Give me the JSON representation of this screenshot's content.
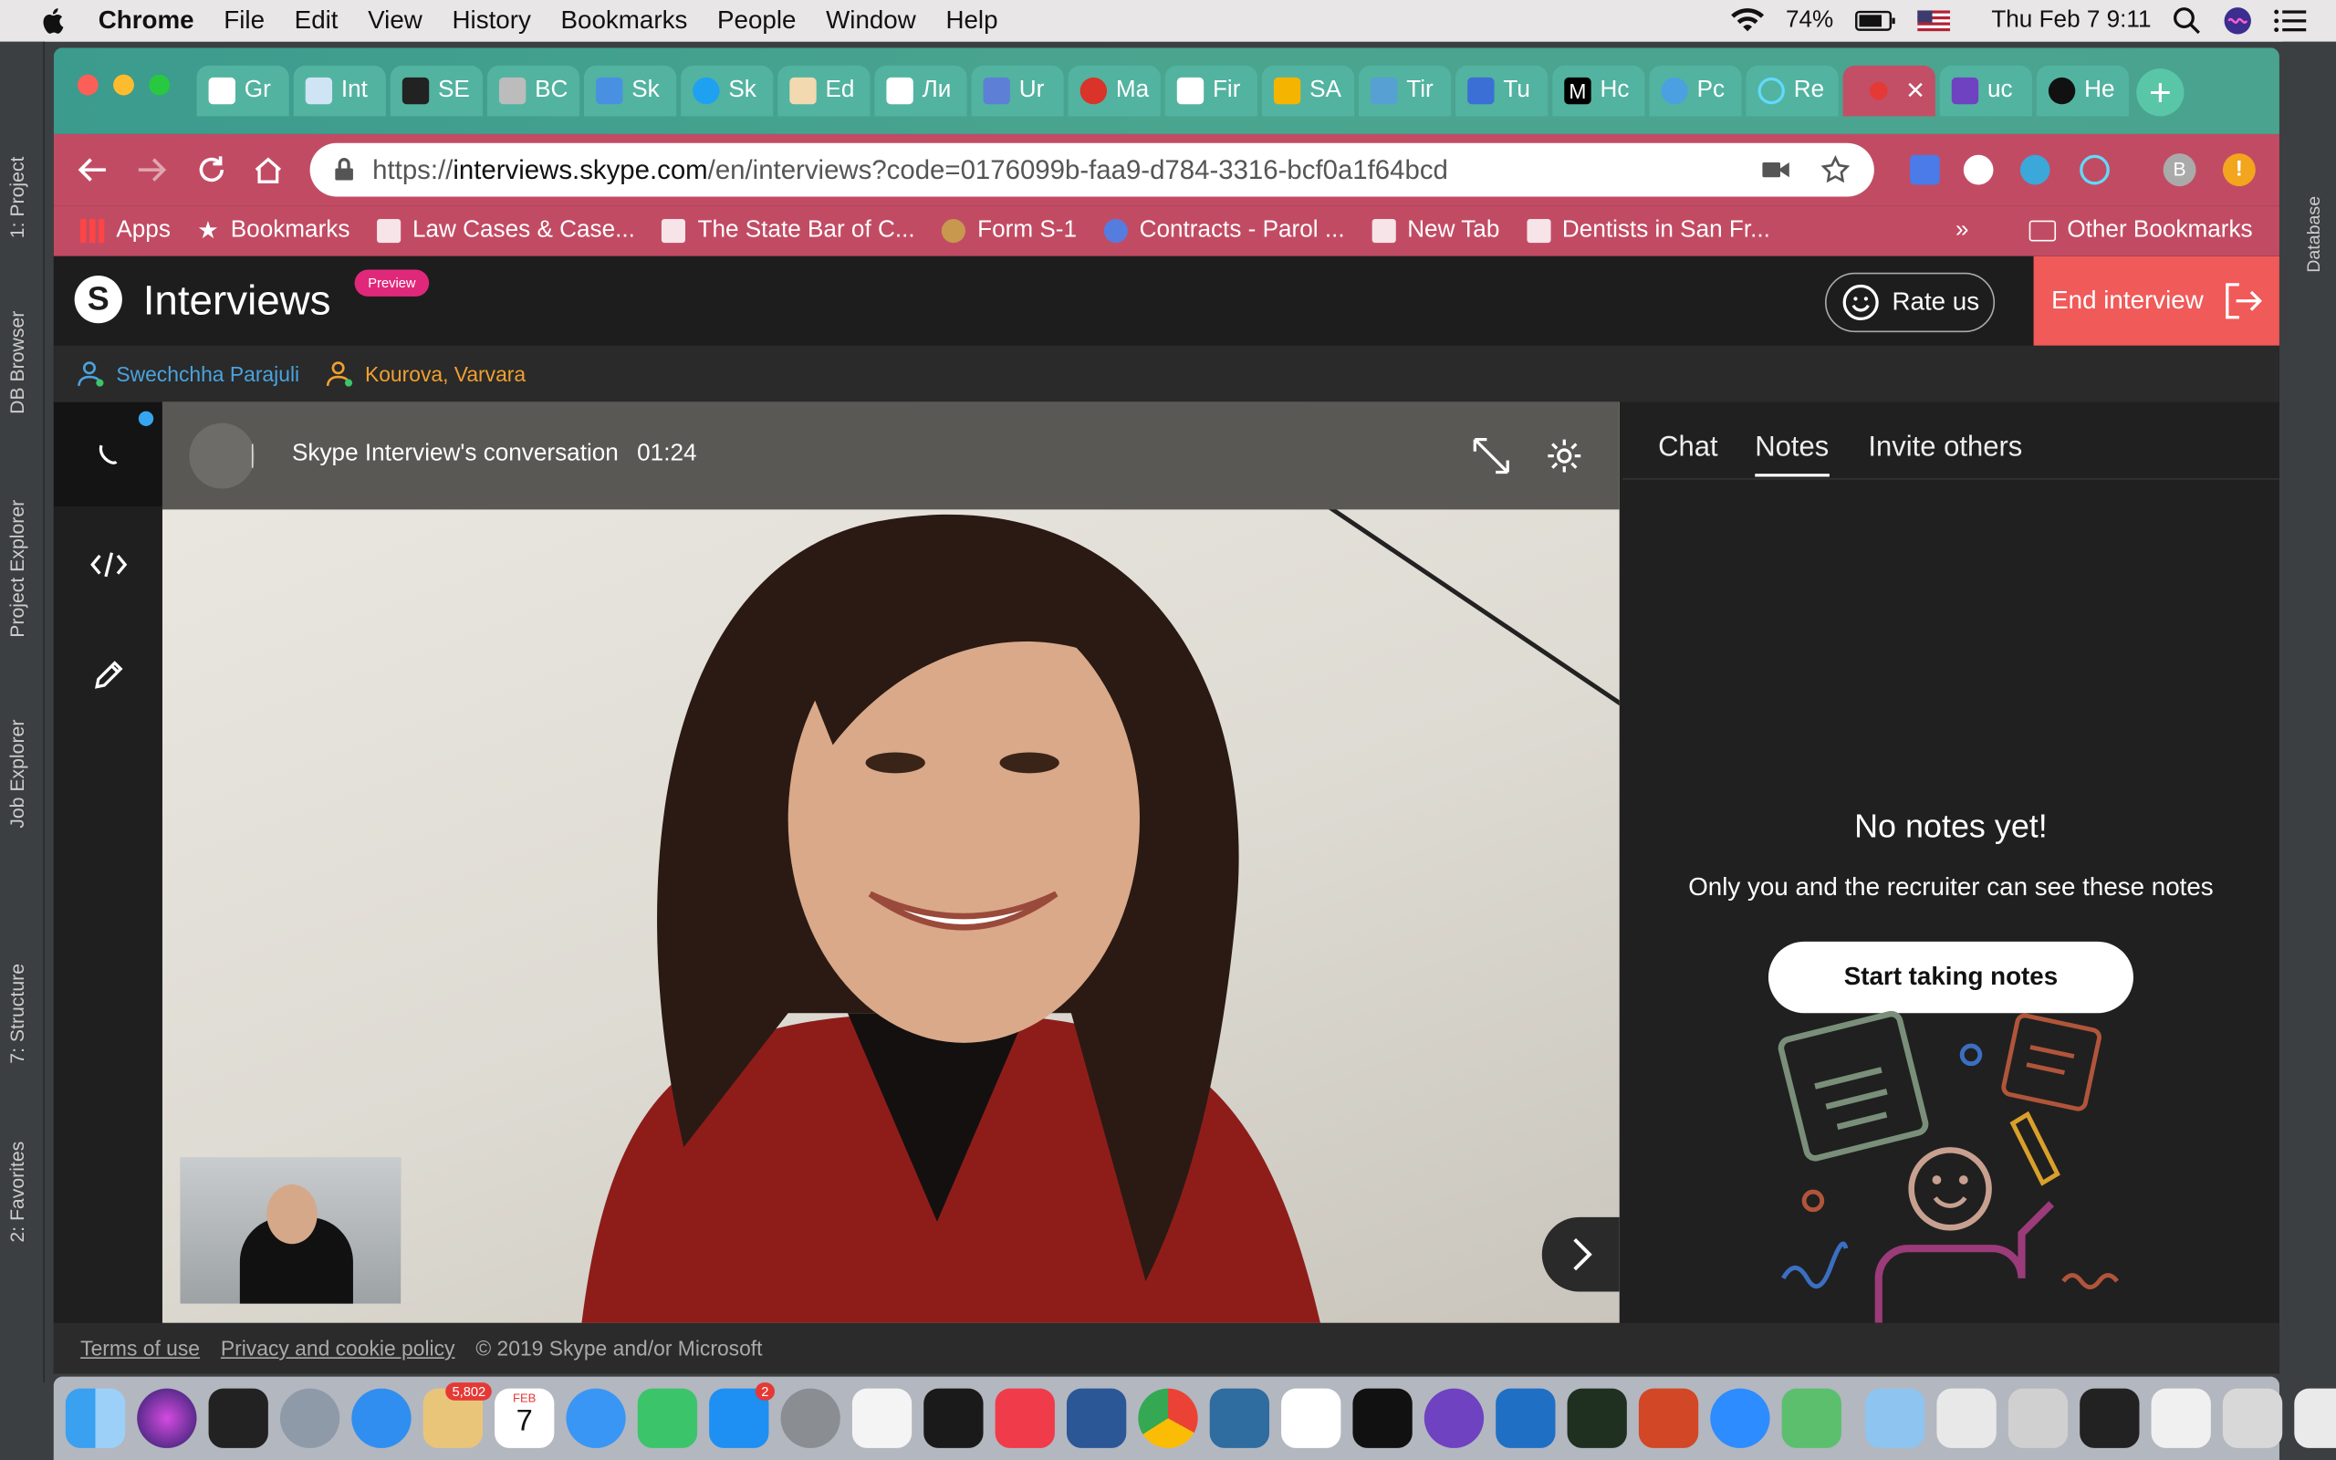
{
  "menubar": {
    "app": "Chrome",
    "items": [
      "File",
      "Edit",
      "View",
      "History",
      "Bookmarks",
      "People",
      "Window",
      "Help"
    ],
    "battery": "74%",
    "datetime": "Thu Feb 7  9:11"
  },
  "ide": {
    "left_tabs": [
      "1: Project",
      "DB Browser",
      "Project Explorer",
      "Job Explorer",
      "7: Structure",
      "2: Favorites"
    ],
    "right_tabs": [
      "Database"
    ]
  },
  "tabs": [
    {
      "label": "Gr",
      "icon": "doc-icon",
      "color": "#ffffff"
    },
    {
      "label": "Int",
      "icon": "bank-icon",
      "color": "#e9e9e9"
    },
    {
      "label": "SE",
      "icon": "r-icon",
      "color": "#222222"
    },
    {
      "label": "BC",
      "icon": "gear-globe-icon",
      "color": "#bcbcbc"
    },
    {
      "label": "Sk",
      "icon": "robot-icon",
      "color": "#4a90e2"
    },
    {
      "label": "Sk",
      "icon": "skype-icon",
      "color": "#1ea1f1"
    },
    {
      "label": "Ed",
      "icon": "pen-icon",
      "color": "#f3d9b0"
    },
    {
      "label": "Ли",
      "icon": "doc-icon",
      "color": "#ffffff"
    },
    {
      "label": "Ur",
      "icon": "wave-icon",
      "color": "#5d7fd6"
    },
    {
      "label": "Ma",
      "icon": "flower-icon",
      "color": "#d9332a"
    },
    {
      "label": "Fir",
      "icon": "picture-icon",
      "color": "#ffffff"
    },
    {
      "label": "SA",
      "icon": "slides-icon",
      "color": "#f4b400"
    },
    {
      "label": "Tir",
      "icon": "clock-icon",
      "color": "#56a0d3"
    },
    {
      "label": "Tu",
      "icon": "cube-icon",
      "color": "#3b6fd6"
    },
    {
      "label": "Hc",
      "icon": "medium-icon",
      "color": "#000000"
    },
    {
      "label": "Pc",
      "icon": "globe-icon",
      "color": "#4aa0e0"
    },
    {
      "label": "Re",
      "icon": "react-icon",
      "color": "#61dafb"
    },
    {
      "label": "",
      "icon": "record-icon",
      "color": "#e53935",
      "active": true
    },
    {
      "label": "uc",
      "icon": "h-icon",
      "color": "#6f42c1"
    },
    {
      "label": "He",
      "icon": "github-icon",
      "color": "#111111"
    }
  ],
  "url": {
    "prefix": "https://",
    "host": "interviews.skype.com",
    "path": "/en/interviews?code=0176099b-faa9-d784-3316-bcf0a1f64bcd"
  },
  "profile_initial": "B",
  "bookmarks": [
    "Apps",
    "Bookmarks",
    "Law Cases & Case...",
    "The State Bar of C...",
    "Form S-1",
    "Contracts - Parol ...",
    "New Tab",
    "Dentists in San Fr..."
  ],
  "bookmarks_more": "»",
  "bookmarks_other": "Other Bookmarks",
  "app": {
    "title": "Interviews",
    "badge": "Preview",
    "rate_label": "Rate us",
    "end_label": "End interview"
  },
  "participants": [
    {
      "name": "Swechchha Parajuli",
      "color": "#4aa3df"
    },
    {
      "name": "Kourova, Varvara",
      "color": "#f0a030"
    }
  ],
  "conversation": {
    "title": "Skype Interview's conversation",
    "timer": "01:24"
  },
  "panel": {
    "tabs": [
      "Chat",
      "Notes",
      "Invite others"
    ],
    "active_tab": "Notes",
    "empty_title": "No notes yet!",
    "empty_sub": "Only you and the recruiter can see these notes",
    "cta": "Start taking notes"
  },
  "footer": {
    "terms": "Terms of use",
    "privacy": "Privacy and cookie policy",
    "copyright": "© 2019 Skype and/or Microsoft"
  },
  "dock": {
    "badges": {
      "photos": "5,802",
      "appstore": "2"
    },
    "calendar_month": "FEB",
    "calendar_day": "7"
  },
  "colors": {
    "tabstrip": "#4aa58f",
    "toolbar": "#c24b64",
    "end_button": "#f05a59",
    "preview_badge": "#e0287b"
  }
}
